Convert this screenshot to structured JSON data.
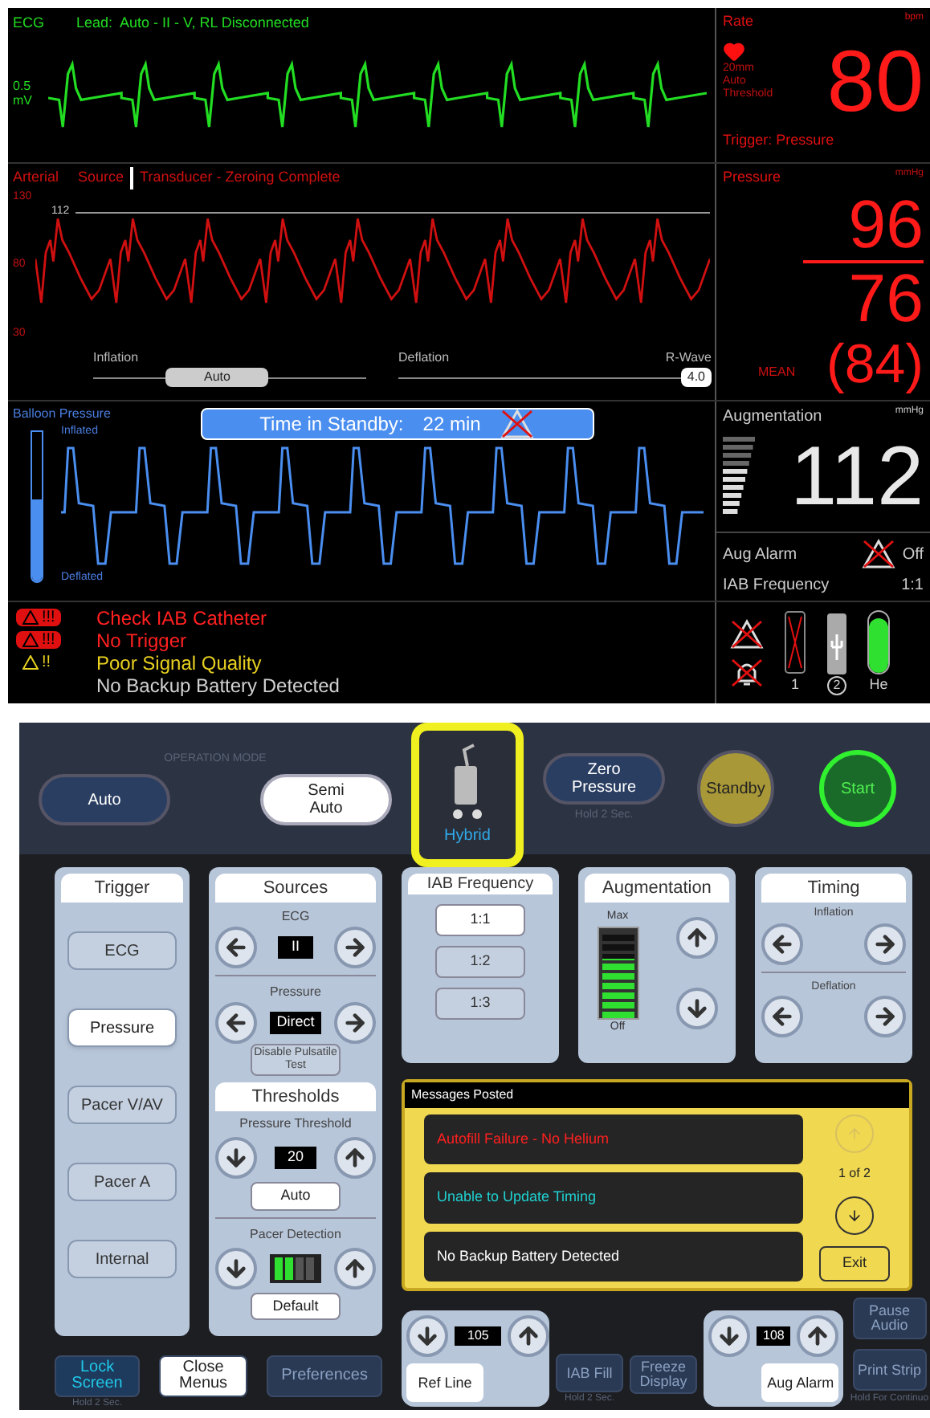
{
  "monitor": {
    "ecg": {
      "label": "ECG",
      "lead": "Lead:  Auto - II - V, RL Disconnected",
      "scale_value": "0.5",
      "scale_unit": "mV"
    },
    "rate": {
      "label": "Rate",
      "unit": "bpm",
      "notes": [
        "20mm",
        "Auto",
        "Threshold"
      ],
      "value": "80",
      "trigger": "Trigger: Pressure"
    },
    "arterial": {
      "label": "Arterial",
      "source": "Source",
      "status": "Transducer - Zeroing Complete",
      "y_ticks": [
        "130",
        "80",
        "30"
      ],
      "reference": "112",
      "inflation": "Inflation",
      "auto": "Auto",
      "deflation": "Deflation",
      "r_wave": "R-Wave",
      "r_wave_value": "4.0"
    },
    "pressure": {
      "label": "Pressure",
      "unit": "mmHg",
      "systolic": "96",
      "diastolic": "76",
      "mean_label": "MEAN",
      "mean": "(84)"
    },
    "balloon": {
      "label": "Balloon Pressure",
      "inflated": "Inflated",
      "deflated": "Deflated",
      "level": 0.55,
      "standby_label": "Time in Standby:",
      "standby_time": "22 min"
    },
    "augmentation": {
      "label": "Augmentation",
      "unit": "mmHg",
      "value": "112",
      "alarm_label": "Aug Alarm",
      "alarm_value": "Off",
      "frequency_label": "IAB Frequency",
      "frequency_value": "1:1"
    },
    "alarms": [
      {
        "kind": "high",
        "badge": "!!!",
        "text": "Check IAB Catheter"
      },
      {
        "kind": "high",
        "badge": "!!!",
        "text": "No Trigger"
      },
      {
        "kind": "medium",
        "badge": "!!",
        "text": "Poor Signal Quality"
      },
      {
        "kind": "info",
        "text": "No Backup Battery Detected"
      }
    ],
    "status": {
      "battery_1": "1",
      "battery_2": "2",
      "helium": {
        "label": "He",
        "level": 0.9
      }
    }
  },
  "controls": {
    "operation_mode": {
      "label": "OPERATION MODE",
      "modes": [
        {
          "label": "Auto",
          "selected": false
        },
        {
          "label": "Semi Auto",
          "selected": true
        }
      ]
    },
    "hybrid": {
      "label": "Hybrid",
      "highlighted": true
    },
    "zero_pressure": {
      "label": "Zero Pressure",
      "hint": "Hold 2 Sec."
    },
    "standby": "Standby",
    "start": "Start",
    "trigger": {
      "title": "Trigger",
      "items": [
        {
          "label": "ECG",
          "selected": false
        },
        {
          "label": "Pressure",
          "selected": true
        },
        {
          "label": "Pacer V/AV",
          "selected": false
        },
        {
          "label": "Pacer A",
          "selected": false
        },
        {
          "label": "Internal",
          "selected": false
        }
      ]
    },
    "sources": {
      "title": "Sources",
      "ecg_label": "ECG",
      "ecg_value": "II",
      "pressure_label": "Pressure",
      "pressure_value": "Direct",
      "disable": "Disable Pulsatile Test"
    },
    "thresholds": {
      "title": "Thresholds",
      "pressure_label": "Pressure Threshold",
      "pressure_value": "20",
      "auto": "Auto",
      "pacer_label": "Pacer Detection",
      "pacer_meter": {
        "level": 0.5
      },
      "default": "Default"
    },
    "iab_frequency": {
      "title": "IAB Frequency",
      "items": [
        {
          "label": "1:1",
          "selected": true
        },
        {
          "label": "1:2",
          "selected": false
        },
        {
          "label": "1:3",
          "selected": false
        }
      ]
    },
    "augmentation": {
      "title": "Augmentation",
      "max": "Max",
      "min": "Off",
      "level": 0.67
    },
    "timing": {
      "title": "Timing",
      "inflation": "Inflation",
      "deflation": "Deflation"
    },
    "messages": {
      "title": "Messages Posted",
      "items": [
        {
          "kind": "alarm",
          "text": "Autofill Failure - No Helium"
        },
        {
          "kind": "advisory",
          "text": "Unable to Update Timing"
        },
        {
          "kind": "info",
          "text": "No Backup Battery Detected"
        }
      ],
      "page": "1 of 2",
      "exit": "Exit"
    },
    "ref_line": {
      "value": "105",
      "label": "Ref Line"
    },
    "aug_alarm": {
      "value": "108",
      "label": "Aug Alarm"
    },
    "bottom_left": [
      {
        "label": "Lock Screen",
        "kind": "cyan",
        "hint": "Hold 2 Sec."
      },
      {
        "label": "Close Menus",
        "kind": "light"
      },
      {
        "label": "Preferences",
        "kind": "dark"
      }
    ],
    "bottom_right": [
      {
        "label": "IAB Fill",
        "hint": "Hold 2 Sec."
      },
      {
        "label": "Freeze Display"
      }
    ],
    "pause_audio": "Pause Audio",
    "print_strip": {
      "label": "Print Strip",
      "hint": "Hold For Continuo"
    }
  }
}
